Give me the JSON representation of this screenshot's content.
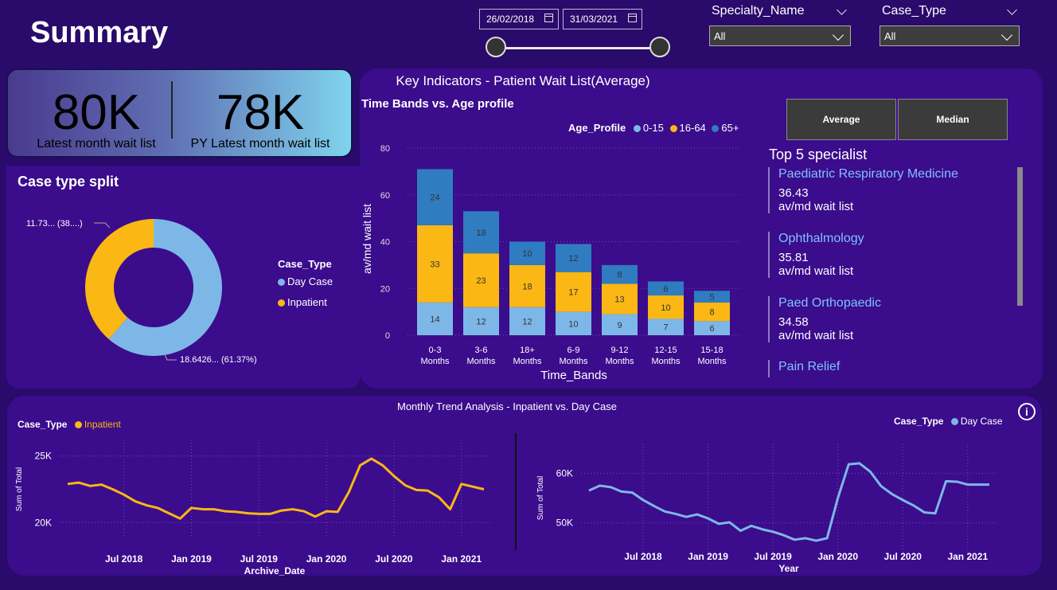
{
  "page": {
    "title": "Summary"
  },
  "date_filter": {
    "start": "26/02/2018",
    "end": "31/03/2021"
  },
  "filters": [
    {
      "label": "Specialty_Name",
      "value": "All"
    },
    {
      "label": "Case_Type",
      "value": "All"
    }
  ],
  "kpis": [
    {
      "value": "80K",
      "label": "Latest month wait list"
    },
    {
      "value": "78K",
      "label": "PY Latest month wait list"
    }
  ],
  "case_split": {
    "title": "Case type split",
    "legend_title": "Case_Type",
    "legend": [
      {
        "name": "Day Case",
        "color": "#7db7e8"
      },
      {
        "name": "Inpatient",
        "color": "#fbb714"
      }
    ],
    "labels": {
      "inpatient": "11.73... (38....)",
      "daycase": "18.6426... (61.37%)"
    }
  },
  "key_indicators": {
    "title": "Key Indicators - Patient Wait List(Average)",
    "buttons": {
      "average": "Average",
      "median": "Median"
    }
  },
  "top5": {
    "title": "Top 5 specialist",
    "items": [
      {
        "name": "Paediatric Respiratory Medicine",
        "value": "36.43",
        "sub": "av/md wait list"
      },
      {
        "name": "Ophthalmology",
        "value": "35.81",
        "sub": "av/md wait list"
      },
      {
        "name": "Paed Orthopaedic",
        "value": "34.58",
        "sub": "av/md wait list"
      },
      {
        "name": "Pain Relief",
        "value": "",
        "sub": ""
      }
    ]
  },
  "trend": {
    "title": "Monthly Trend Analysis  - Inpatient vs. Day Case"
  },
  "chart_data": [
    {
      "type": "pie",
      "title": "Case type split",
      "slices": [
        {
          "name": "Day Case",
          "value": 61.37,
          "color": "#7db7e8"
        },
        {
          "name": "Inpatient",
          "value": 38.63,
          "color": "#fbb714"
        }
      ]
    },
    {
      "type": "bar",
      "stacked": true,
      "title": "Time Bands vs. Age profile",
      "legend_title": "Age_Profile",
      "xlabel": "Time_Bands",
      "ylabel": "av/md wait list",
      "categories": [
        "0-3 Months",
        "3-6 Months",
        "18+ Months",
        "6-9 Months",
        "9-12 Months",
        "12-15 Months",
        "15-18 Months"
      ],
      "ylim": [
        0,
        80
      ],
      "yticks": [
        0,
        20,
        40,
        60,
        80
      ],
      "series": [
        {
          "name": "0-15",
          "color": "#7db7e8",
          "values": [
            14,
            12,
            12,
            10,
            9,
            7,
            6
          ]
        },
        {
          "name": "16-64",
          "color": "#fbb714",
          "values": [
            33,
            23,
            18,
            17,
            13,
            10,
            8
          ]
        },
        {
          "name": "65+",
          "color": "#2f7cc0",
          "values": [
            24,
            18,
            10,
            12,
            8,
            6,
            5
          ]
        }
      ]
    },
    {
      "type": "line",
      "legend_title": "Case_Type",
      "series_name": "Inpatient",
      "color": "#fbb714",
      "xlabel": "Archive_Date",
      "ylabel": "Sum of Total",
      "xticks": [
        "Jul 2018",
        "Jan 2019",
        "Jul 2019",
        "Jan 2020",
        "Jul 2020",
        "Jan 2021"
      ],
      "yticks": [
        "20K",
        "25K"
      ],
      "ylim": [
        19000,
        26000
      ],
      "x": [
        "2018-02",
        "2018-03",
        "2018-04",
        "2018-05",
        "2018-06",
        "2018-07",
        "2018-08",
        "2018-09",
        "2018-10",
        "2018-11",
        "2018-12",
        "2019-01",
        "2019-02",
        "2019-03",
        "2019-04",
        "2019-05",
        "2019-06",
        "2019-07",
        "2019-08",
        "2019-09",
        "2019-10",
        "2019-11",
        "2019-12",
        "2020-01",
        "2020-02",
        "2020-03",
        "2020-04",
        "2020-05",
        "2020-06",
        "2020-07",
        "2020-08",
        "2020-09",
        "2020-10",
        "2020-11",
        "2020-12",
        "2021-01",
        "2021-02",
        "2021-03"
      ],
      "values": [
        22900,
        23000,
        22750,
        22850,
        22500,
        22100,
        21600,
        21300,
        21100,
        20700,
        20300,
        21100,
        21000,
        21000,
        20850,
        20800,
        20700,
        20650,
        20650,
        20900,
        21000,
        20850,
        20450,
        20850,
        20800,
        22300,
        24300,
        24800,
        24300,
        23500,
        22800,
        22450,
        22400,
        21900,
        21000,
        22900,
        22700,
        22500
      ]
    },
    {
      "type": "line",
      "legend_title": "Case_Type",
      "series_name": "Day Case",
      "color": "#7db7e8",
      "xlabel": "Year",
      "ylabel": "Sum of Total",
      "xticks": [
        "Jul 2018",
        "Jan 2019",
        "Jul 2019",
        "Jan 2020",
        "Jul 2020",
        "Jan 2021"
      ],
      "yticks": [
        "50K",
        "60K"
      ],
      "ylim": [
        44000,
        66000
      ],
      "x": [
        "2018-02",
        "2018-03",
        "2018-04",
        "2018-05",
        "2018-06",
        "2018-07",
        "2018-08",
        "2018-09",
        "2018-10",
        "2018-11",
        "2018-12",
        "2019-01",
        "2019-02",
        "2019-03",
        "2019-04",
        "2019-05",
        "2019-06",
        "2019-07",
        "2019-08",
        "2019-09",
        "2019-10",
        "2019-11",
        "2019-12",
        "2020-01",
        "2020-02",
        "2020-03",
        "2020-04",
        "2020-05",
        "2020-06",
        "2020-07",
        "2020-08",
        "2020-09",
        "2020-10",
        "2020-11",
        "2020-12",
        "2021-01",
        "2021-02",
        "2021-03"
      ],
      "values": [
        56500,
        57500,
        57200,
        56300,
        56100,
        54600,
        53400,
        52300,
        51800,
        51200,
        51700,
        50900,
        49800,
        50100,
        48400,
        49400,
        48700,
        48200,
        47500,
        46600,
        46900,
        46400,
        46900,
        55000,
        61800,
        62000,
        60300,
        57400,
        55800,
        54600,
        53500,
        52100,
        51900,
        58400,
        58300,
        57700,
        57700,
        57700
      ]
    }
  ]
}
